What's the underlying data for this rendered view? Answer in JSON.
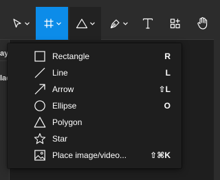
{
  "toolbar": {
    "tools": [
      {
        "name": "move-tool",
        "icon": "cursor-arrow-icon",
        "has_dropdown": true
      },
      {
        "name": "frame-tool",
        "icon": "frame-hash-icon",
        "has_dropdown": true,
        "active": true
      },
      {
        "name": "shape-tool",
        "icon": "triangle-icon",
        "has_dropdown": true
      },
      {
        "name": "pen-tool",
        "icon": "pen-nib-icon",
        "has_dropdown": true
      },
      {
        "name": "text-tool",
        "icon": "text-t-icon",
        "has_dropdown": false
      },
      {
        "name": "resources-tool",
        "icon": "components-icon",
        "has_dropdown": false
      },
      {
        "name": "hand-tool",
        "icon": "hand-icon",
        "has_dropdown": false
      }
    ],
    "active_color": "#0c8ce9"
  },
  "left_panel": {
    "fragment_1": "aye",
    "fragment_2": "lac"
  },
  "shape_menu": {
    "items": [
      {
        "label": "Rectangle",
        "shortcut": "R",
        "icon": "rectangle-icon"
      },
      {
        "label": "Line",
        "shortcut": "L",
        "icon": "line-icon"
      },
      {
        "label": "Arrow",
        "shortcut": "⇧L",
        "icon": "arrow-icon"
      },
      {
        "label": "Ellipse",
        "shortcut": "O",
        "icon": "ellipse-icon"
      },
      {
        "label": "Polygon",
        "shortcut": "",
        "icon": "polygon-icon"
      },
      {
        "label": "Star",
        "shortcut": "",
        "icon": "star-icon"
      },
      {
        "label": "Place image/video...",
        "shortcut": "⇧⌘K",
        "icon": "image-icon"
      }
    ]
  }
}
